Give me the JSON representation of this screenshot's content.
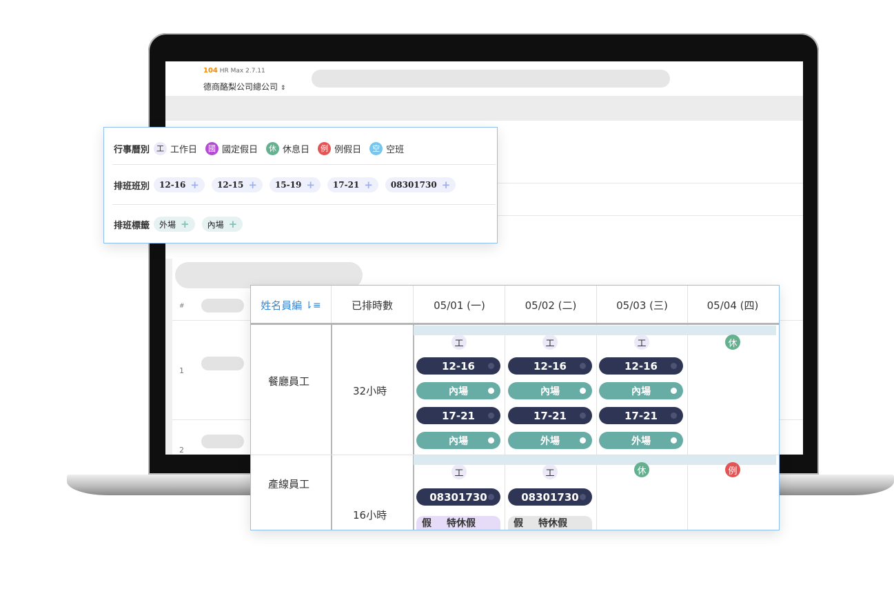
{
  "app": {
    "brand_logo": "104",
    "brand_name": "HR Max",
    "version": "2.7.11",
    "company": "德商酪梨公司總公司",
    "company_caret": "⇕"
  },
  "screen_rows": [
    "#",
    "1",
    "2"
  ],
  "legend": {
    "calendar": {
      "title": "行事曆別",
      "items": [
        {
          "icon": "工",
          "label": "工作日",
          "icon_name": "work-day-icon"
        },
        {
          "icon": "國",
          "label": "國定假日",
          "icon_name": "national-holiday-icon"
        },
        {
          "icon": "休",
          "label": "休息日",
          "icon_name": "rest-day-icon"
        },
        {
          "icon": "例",
          "label": "例假日",
          "icon_name": "regular-holiday-icon"
        },
        {
          "icon": "空",
          "label": "空班",
          "icon_name": "empty-shift-icon"
        }
      ]
    },
    "shifts": {
      "title": "排班班別",
      "items": [
        "12-16",
        "12-15",
        "15-19",
        "17-21",
        "08301730"
      ]
    },
    "tags": {
      "title": "排班標籤",
      "items": [
        "外場",
        "內場"
      ]
    },
    "plus": "+"
  },
  "schedule": {
    "headers": {
      "name": "姓名員編",
      "hours": "已排時數",
      "days": [
        "05/01 (一)",
        "05/02 (二)",
        "05/03 (三)",
        "05/04 (四)"
      ]
    },
    "sort_icon": "⇂≡",
    "employees": [
      {
        "name": "餐廳員工",
        "hours": "32小時",
        "days": [
          {
            "type": "工",
            "entries": [
              {
                "shift": "12-16",
                "tag": "內場"
              },
              {
                "shift": "17-21",
                "tag": "內場"
              }
            ]
          },
          {
            "type": "工",
            "entries": [
              {
                "shift": "12-16",
                "tag": "內場"
              },
              {
                "shift": "17-21",
                "tag": "外場"
              }
            ]
          },
          {
            "type": "工",
            "entries": [
              {
                "shift": "12-16",
                "tag": "內場"
              },
              {
                "shift": "17-21",
                "tag": "外場"
              }
            ]
          },
          {
            "type": "休",
            "entries": []
          }
        ]
      },
      {
        "name": "產線員工",
        "hours": "16小時",
        "days": [
          {
            "type": "工",
            "shift": "08301730",
            "leave_mark": "假",
            "leave": "特休假"
          },
          {
            "type": "工",
            "shift": "08301730",
            "leave_mark": "假",
            "leave": "特休假"
          },
          {
            "type": "休"
          },
          {
            "type": "例"
          }
        ]
      }
    ]
  },
  "colors": {
    "shift_pill": "#2e3555",
    "tag_pill": "#67ada6",
    "rest": "#65b18f",
    "regular_holiday": "#e35555",
    "national_holiday": "#b44bd5",
    "empty_shift": "#78c5ee",
    "accent": "#3b86d1"
  }
}
